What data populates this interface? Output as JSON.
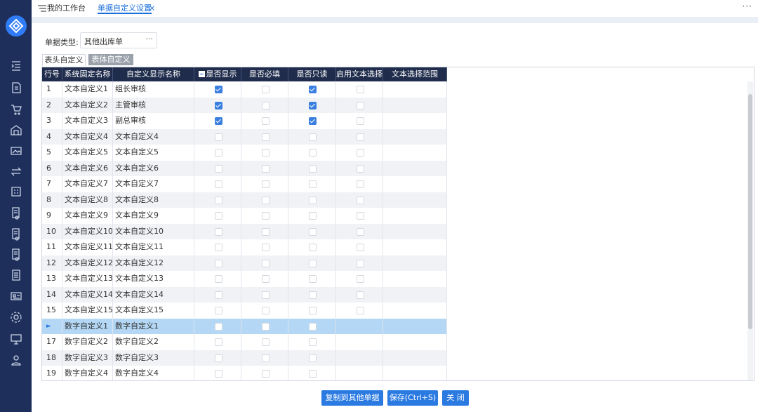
{
  "tabs": {
    "home": "我的工作台",
    "active": "单据自定义设置",
    "close": "×",
    "more": "···"
  },
  "filter": {
    "label": "单据类型:",
    "value": "其他出库单",
    "picker": "···"
  },
  "subtabs": [
    "表头自定义",
    "表体自定义"
  ],
  "columns": [
    "行号",
    "系统固定名称",
    "自定义显示名称",
    "是否显示",
    "是否必填",
    "是否只读",
    "启用文本选择",
    "文本选择范围"
  ],
  "rows": [
    {
      "no": "1",
      "sys": "文本自定义1",
      "custom": "组长审核",
      "show": true,
      "req": false,
      "ro": true
    },
    {
      "no": "2",
      "sys": "文本自定义2",
      "custom": "主管审核",
      "show": true,
      "req": false,
      "ro": true
    },
    {
      "no": "3",
      "sys": "文本自定义3",
      "custom": "副总审核",
      "show": true,
      "req": false,
      "ro": true
    },
    {
      "no": "4",
      "sys": "文本自定义4",
      "custom": "文本自定义4",
      "show": false,
      "req": false,
      "ro": false
    },
    {
      "no": "5",
      "sys": "文本自定义5",
      "custom": "文本自定义5",
      "show": false,
      "req": false,
      "ro": false
    },
    {
      "no": "6",
      "sys": "文本自定义6",
      "custom": "文本自定义6",
      "show": false,
      "req": false,
      "ro": false
    },
    {
      "no": "7",
      "sys": "文本自定义7",
      "custom": "文本自定义7",
      "show": false,
      "req": false,
      "ro": false
    },
    {
      "no": "8",
      "sys": "文本自定义8",
      "custom": "文本自定义8",
      "show": false,
      "req": false,
      "ro": false
    },
    {
      "no": "9",
      "sys": "文本自定义9",
      "custom": "文本自定义9",
      "show": false,
      "req": false,
      "ro": false
    },
    {
      "no": "10",
      "sys": "文本自定义10",
      "custom": "文本自定义10",
      "show": false,
      "req": false,
      "ro": false
    },
    {
      "no": "11",
      "sys": "文本自定义11",
      "custom": "文本自定义11",
      "show": false,
      "req": false,
      "ro": false
    },
    {
      "no": "12",
      "sys": "文本自定义12",
      "custom": "文本自定义12",
      "show": false,
      "req": false,
      "ro": false
    },
    {
      "no": "13",
      "sys": "文本自定义13",
      "custom": "文本自定义13",
      "show": false,
      "req": false,
      "ro": false
    },
    {
      "no": "14",
      "sys": "文本自定义14",
      "custom": "文本自定义14",
      "show": false,
      "req": false,
      "ro": false
    },
    {
      "no": "15",
      "sys": "文本自定义15",
      "custom": "文本自定义15",
      "show": false,
      "req": false,
      "ro": false
    },
    {
      "no": "►",
      "sys": "数字自定义1",
      "custom": "数字自定义1",
      "show": false,
      "req": false,
      "ro": false,
      "selected": true,
      "numeric": true
    },
    {
      "no": "17",
      "sys": "数字自定义2",
      "custom": "数字自定义2",
      "show": false,
      "req": false,
      "ro": false,
      "numeric": true
    },
    {
      "no": "18",
      "sys": "数字自定义3",
      "custom": "数字自定义3",
      "show": false,
      "req": false,
      "ro": false,
      "numeric": true
    },
    {
      "no": "19",
      "sys": "数字自定义4",
      "custom": "数字自定义4",
      "show": false,
      "req": false,
      "ro": false,
      "numeric": true
    }
  ],
  "buttons": {
    "copy": "复制到其他单据",
    "save": "保存(Ctrl+S)",
    "close": "关 闭"
  },
  "colors": {
    "sidebar": "#1e2f5b",
    "header": "#1f2c4c",
    "accent": "#2a7ae2",
    "selected_row": "#b3d7f5",
    "alt_row": "#f0f2f5"
  },
  "sidebar_icons": [
    "indent-icon",
    "document-icon",
    "cart-icon",
    "warehouse-icon",
    "image-board-icon",
    "transfer-icon",
    "calculator-icon",
    "report-icon",
    "report-icon",
    "report-icon",
    "list-doc-icon",
    "id-card-icon",
    "settings-icon",
    "monitor-icon",
    "user-icon"
  ]
}
